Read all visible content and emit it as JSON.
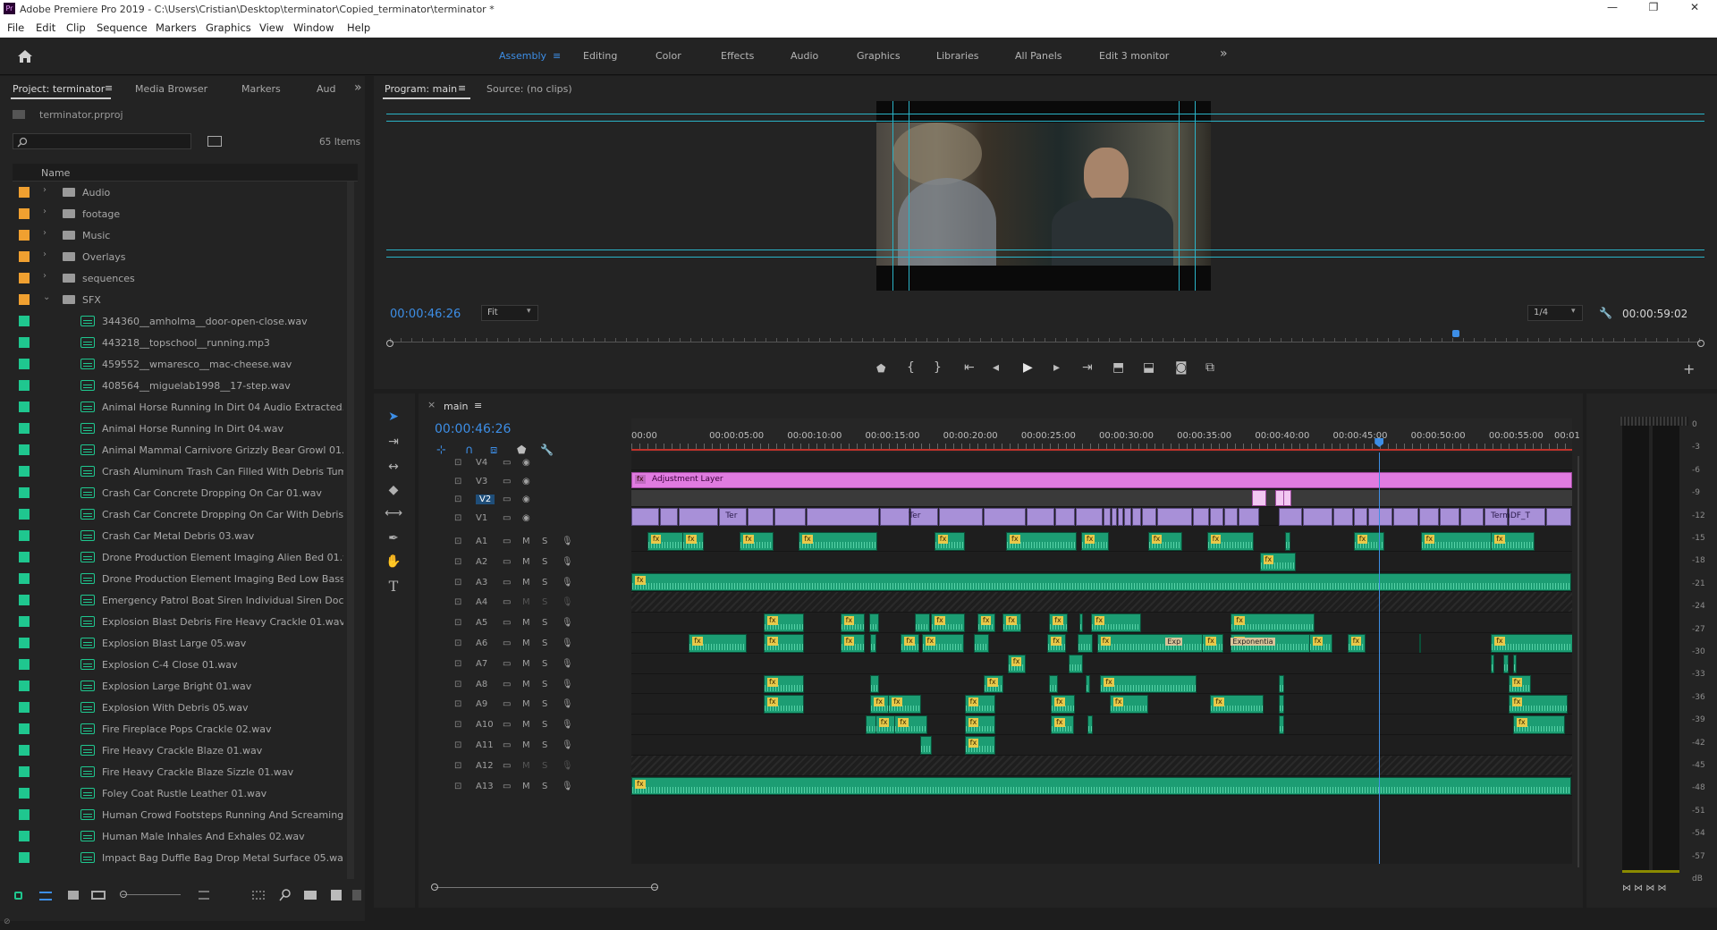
{
  "window": {
    "title": "Adobe Premiere Pro 2019 - C:\\Users\\Cristian\\Desktop\\terminator\\Copied_terminator\\terminator *",
    "logo": "Pr",
    "minimize": "—",
    "maximize": "❐",
    "close": "✕"
  },
  "menu": [
    "File",
    "Edit",
    "Clip",
    "Sequence",
    "Markers",
    "Graphics",
    "View",
    "Window",
    "Help"
  ],
  "workspaces": [
    "Assembly",
    "Editing",
    "Color",
    "Effects",
    "Audio",
    "Graphics",
    "Libraries",
    "All Panels",
    "Edit 3 monitor"
  ],
  "workspace_menu_icon": "≡",
  "workspace_more": "»",
  "project": {
    "tabs": [
      "Project: terminator",
      "Media Browser",
      "Markers",
      "Aud"
    ],
    "tab_menu": "≡",
    "more": "»",
    "file": "terminator.prproj",
    "items_count": "65 Items",
    "column_name": "Name",
    "folders": [
      {
        "label": "Audio",
        "color": "#f0a030",
        "expanded": false
      },
      {
        "label": "footage",
        "color": "#f0a030",
        "expanded": false
      },
      {
        "label": "Music",
        "color": "#f0a030",
        "expanded": false
      },
      {
        "label": "Overlays",
        "color": "#f0a030",
        "expanded": false
      },
      {
        "label": "sequences",
        "color": "#f0a030",
        "expanded": false
      },
      {
        "label": "SFX",
        "color": "#f0a030",
        "expanded": true
      }
    ],
    "files": [
      "344360__amholma__door-open-close.wav",
      "443218__topschool__running.mp3",
      "459552__wmaresco__mac-cheese.wav",
      "408564__miguelab1998__17-step.wav",
      "Animal Horse Running In Dirt 04 Audio Extracted.wav",
      "Animal Horse Running In Dirt 04.wav",
      "Animal Mammal Carnivore Grizzly Bear Growl 01.wa",
      "Crash Aluminum Trash Can Filled With Debris Tumblin",
      "Crash Car Concrete Dropping On Car 01.wav",
      "Crash Car Concrete Dropping On Car With Debris 01.w",
      "Crash Car Metal Debris 03.wav",
      "Drone Production Element Imaging Alien Bed 01.wav",
      "Drone Production Element Imaging Bed Low Bass Sta",
      "Emergency Patrol Boat Siren Individual Siren Docked",
      "Explosion Blast Debris Fire Heavy Crackle 01.wav",
      "Explosion Blast Large 05.wav",
      "Explosion C-4 Close 01.wav",
      "Explosion Large Bright 01.wav",
      "Explosion With Debris 05.wav",
      "Fire Fireplace Pops Crackle 02.wav",
      "Fire Heavy Crackle Blaze 01.wav",
      "Fire Heavy Crackle Blaze Sizzle 01.wav",
      "Foley Coat Rustle Leather 01.wav",
      "Human Crowd Footsteps Running And Screaming 02.",
      "Human Male Inhales And Exhales 02.wav",
      "Impact Bag Duffle Bag Drop Metal Surface 05.wav"
    ],
    "file_color": "#1fc78f"
  },
  "program": {
    "tab": "Program: main",
    "tab_menu": "≡",
    "source_tab": "Source: (no clips)",
    "timecode": "00:00:46:26",
    "fit": "Fit",
    "resolution": "1/4",
    "duration": "00:00:59:02",
    "playhead_fraction": 0.813
  },
  "timeline": {
    "tab": "main",
    "close": "×",
    "tab_menu": "≡",
    "timecode": "00:00:46:26",
    "ruler": [
      "00:00",
      "00:00:05:00",
      "00:00:10:00",
      "00:00:15:00",
      "00:00:20:00",
      "00:00:25:00",
      "00:00:30:00",
      "00:00:35:00",
      "00:00:40:00",
      "00:00:45:00",
      "00:00:50:00",
      "00:00:55:00",
      "00:01"
    ],
    "playhead_seconds": 46.9,
    "video_tracks": [
      "V4",
      "V3",
      "V2",
      "V1"
    ],
    "audio_tracks": [
      "A1",
      "A2",
      "A3",
      "A4",
      "A5",
      "A6",
      "A7",
      "A8",
      "A9",
      "A10",
      "A11",
      "A12",
      "A13"
    ],
    "m": "M",
    "s": "S",
    "adjustment_label": "Adjustment Layer",
    "clip_labels": {
      "ter1": "Ter",
      "ter2": "Ter",
      "termdf": "TermDF_T",
      "exp": "Exponentia",
      "exp_short": "Exp"
    },
    "fx": "fx"
  },
  "meter": {
    "ticks": [
      "0",
      "-3",
      "-6",
      "-9",
      "-12",
      "-15",
      "-18",
      "-21",
      "-24",
      "-27",
      "-30",
      "-33",
      "-36",
      "-39",
      "-42",
      "-45",
      "-48",
      "-51",
      "-54",
      "-57",
      "dB"
    ]
  }
}
